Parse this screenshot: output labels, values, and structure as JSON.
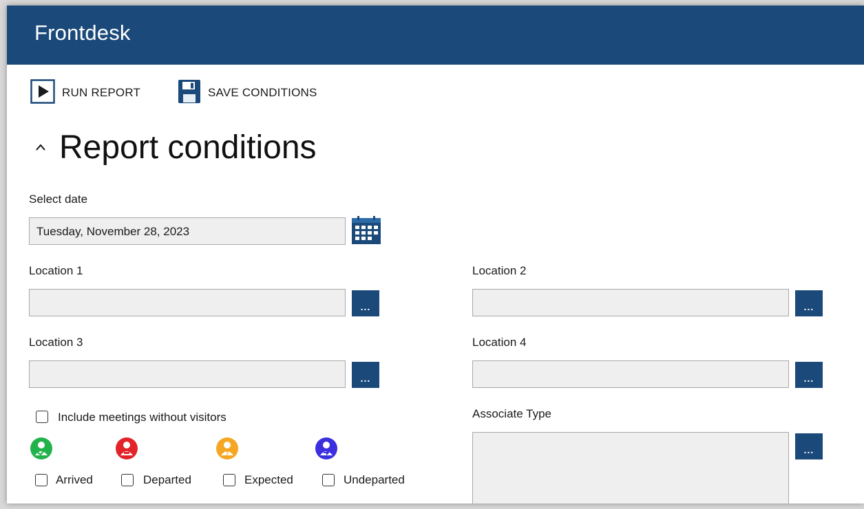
{
  "app": {
    "title": "Frontdesk",
    "accent": "#1b4a7a"
  },
  "toolbar": {
    "run_report": {
      "label": "RUN REPORT",
      "icon": "play-icon"
    },
    "save_conditions": {
      "label": "SAVE CONDITIONS",
      "icon": "save-icon"
    }
  },
  "section": {
    "title": "Report conditions",
    "icon": "chevron-up-icon"
  },
  "date": {
    "label": "Select date",
    "value": "Tuesday, November 28, 2023",
    "icon": "calendar-icon"
  },
  "locations": {
    "loc1": {
      "label": "Location 1",
      "value": "",
      "button": "..."
    },
    "loc2": {
      "label": "Location 2",
      "value": "",
      "button": "..."
    },
    "loc3": {
      "label": "Location 3",
      "value": "",
      "button": "..."
    },
    "loc4": {
      "label": "Location 4",
      "value": "",
      "button": "..."
    }
  },
  "include_meetings": {
    "label": "Include meetings without visitors",
    "checked": false
  },
  "statuses": {
    "arrived": {
      "label": "Arrived",
      "color": "#22b24c",
      "checked": false
    },
    "departed": {
      "label": "Departed",
      "color": "#e2232a",
      "checked": false
    },
    "expected": {
      "label": "Expected",
      "color": "#f5a623",
      "checked": false
    },
    "undeparted": {
      "label": "Undeparted",
      "color": "#3b2fe0",
      "checked": false
    }
  },
  "associate_type": {
    "label": "Associate Type",
    "value": "",
    "button": "..."
  }
}
